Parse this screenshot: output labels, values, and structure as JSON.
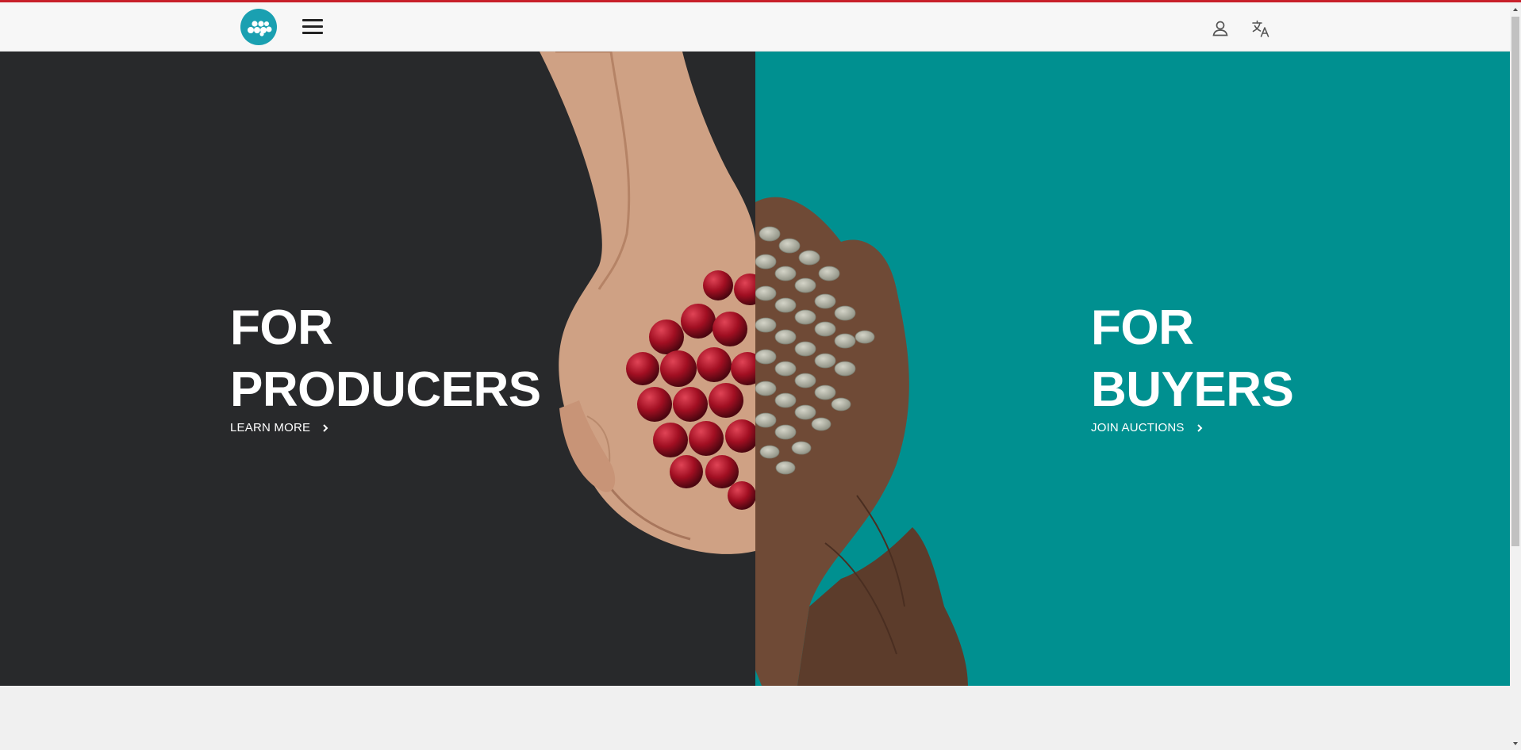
{
  "colors": {
    "accent_line": "#c8202a",
    "logo": "#1aa0b1",
    "producers_bg": "#28292b",
    "buyers_bg": "#009090",
    "nav_bg": "#f7f7f7"
  },
  "navbar": {
    "logo_icon": "m-dots-logo",
    "menu_icon": "hamburger-icon",
    "user_icon": "user-icon",
    "language_icon": "translate-icon"
  },
  "hero": {
    "producers": {
      "title_line1": "FOR",
      "title_line2": "PRODUCERS",
      "link_label": "LEARN MORE",
      "link_icon": "chevron-right-icon"
    },
    "buyers": {
      "title_line1": "FOR",
      "title_line2": "BUYERS",
      "link_label": "JOIN AUCTIONS",
      "link_icon": "chevron-right-icon"
    },
    "image": "hands-holding-coffee-cherries-and-green-beans"
  }
}
